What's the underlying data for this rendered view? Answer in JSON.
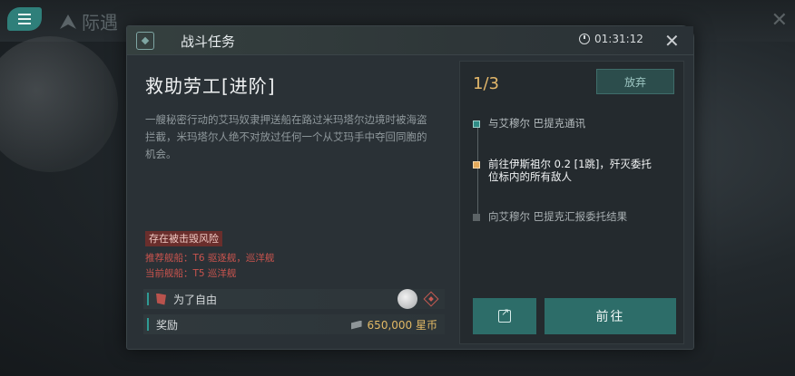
{
  "background": {
    "logo_text": "际遇",
    "close_glyph": "✕"
  },
  "dialog": {
    "title": "战斗任务",
    "timer": "01:31:12",
    "close_glyph": "✕"
  },
  "mission": {
    "title": "救助劳工[进阶]",
    "description": "一艘秘密行动的艾玛奴隶押送船在路过米玛塔尔边境时被海盗拦截，米玛塔尔人绝不对放过任何一个从艾玛手中夺回同胞的机会。",
    "risk_tag": "存在被击毁风险",
    "recommended_ships": "推荐舰船：T6 驱逐舰，巡洋舰",
    "current_ships": "当前舰船：T5 巡洋舰",
    "faction_label": "为了自由",
    "reward_label": "奖励",
    "reward_value": "650,000 星币"
  },
  "objectives": {
    "progress": "1/3",
    "abandon_label": "放弃",
    "steps": [
      {
        "text": "与艾穆尔 巴提克通讯",
        "state": "done"
      },
      {
        "text": "前往伊斯祖尔 0.2 [1跳]，歼灭委托位标内的所有敌人",
        "state": "active"
      },
      {
        "text": "向艾穆尔 巴提克汇报委托结果",
        "state": "pending"
      }
    ],
    "go_label": "前往"
  },
  "colors": {
    "accent_teal": "#2d6d69",
    "progress_gold": "#e3b76a",
    "risk_red": "#c9544e"
  },
  "icons": [
    "menu-icon",
    "mission-icon",
    "clock-icon",
    "close-icon",
    "flag-icon",
    "moon-icon",
    "diamond-icon",
    "credit-icon",
    "share-icon"
  ]
}
